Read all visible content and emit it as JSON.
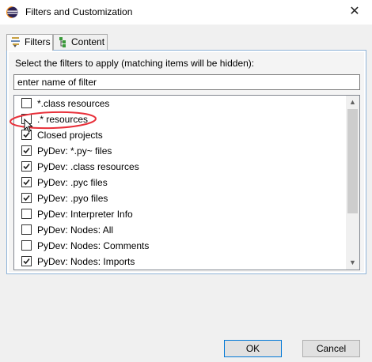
{
  "window": {
    "title": "Filters and Customization",
    "close_glyph": "✕",
    "icon": "eclipse-icon"
  },
  "tabs": [
    {
      "label": "Filters",
      "icon": "filter-icon",
      "active": true
    },
    {
      "label": "Content",
      "icon": "content-tree-icon",
      "active": false
    }
  ],
  "instruction": "Select the filters to apply (matching items will be hidden):",
  "search": {
    "value": "enter name of filter"
  },
  "filters": [
    {
      "label": "*.class resources",
      "checked": false
    },
    {
      "label": ".* resources",
      "checked": false
    },
    {
      "label": "Closed projects",
      "checked": true
    },
    {
      "label": "PyDev: *.py~ files",
      "checked": true
    },
    {
      "label": "PyDev: .class resources",
      "checked": true
    },
    {
      "label": "PyDev: .pyc files",
      "checked": true
    },
    {
      "label": "PyDev: .pyo files",
      "checked": true
    },
    {
      "label": "PyDev: Interpreter Info",
      "checked": false
    },
    {
      "label": "PyDev: Nodes: All",
      "checked": false
    },
    {
      "label": "PyDev: Nodes: Comments",
      "checked": false
    },
    {
      "label": "PyDev: Nodes: Imports",
      "checked": true
    }
  ],
  "buttons": {
    "ok": "OK",
    "cancel": "Cancel"
  },
  "colors": {
    "annotation": "#e8303a",
    "panel_border": "#8fb3d8",
    "ok_border": "#0078d7"
  }
}
